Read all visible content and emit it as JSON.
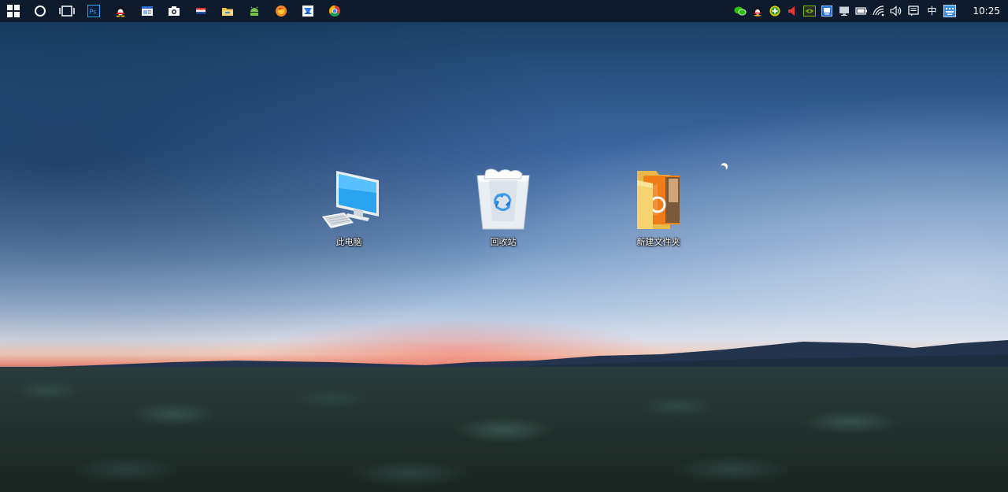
{
  "taskbar": {
    "pinned": [
      {
        "name": "start-button-windows-icon"
      },
      {
        "name": "cortana-circle-icon"
      },
      {
        "name": "task-view-icon"
      },
      {
        "name": "photoshop-icon",
        "text": "Ps"
      },
      {
        "name": "qq-penguin-icon"
      },
      {
        "name": "window-app-icon"
      },
      {
        "name": "camera-app-icon"
      },
      {
        "name": "flag-app-icon"
      },
      {
        "name": "file-explorer-folder-icon"
      },
      {
        "name": "android-icon"
      },
      {
        "name": "firefox-icon"
      },
      {
        "name": "mail-app-icon"
      },
      {
        "name": "chrome-icon"
      }
    ],
    "tray": [
      {
        "name": "wechat-icon"
      },
      {
        "name": "qq-tray-icon"
      },
      {
        "name": "green-plus-icon"
      },
      {
        "name": "speaker-alert-icon"
      },
      {
        "name": "nvidia-icon"
      },
      {
        "name": "blue-app-tray-icon"
      },
      {
        "name": "monitor-tray-icon"
      },
      {
        "name": "battery-icon"
      },
      {
        "name": "wifi-icon"
      },
      {
        "name": "volume-icon"
      },
      {
        "name": "notification-center-icon"
      }
    ],
    "input_method": "中",
    "ime_icon": "keyboard-icon",
    "clock": "10:25"
  },
  "desktop": {
    "icons": [
      {
        "label": "此电脑",
        "icon": "computer-icon"
      },
      {
        "label": "回收站",
        "icon": "recycle-bin-icon"
      },
      {
        "label": "新建文件夹",
        "icon": "folder-icon"
      }
    ]
  },
  "colors": {
    "taskbar_bg": "#0d1b2c",
    "sky_top": "#173659",
    "sunset_pink": "#e9917f"
  }
}
